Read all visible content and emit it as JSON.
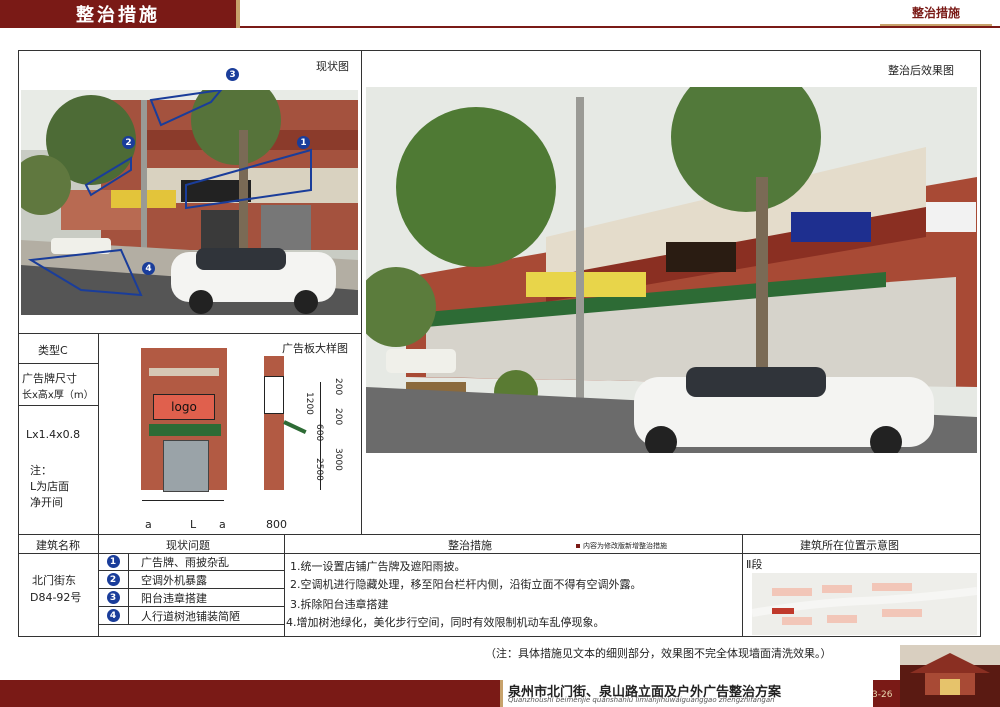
{
  "header": {
    "title": "整治措施",
    "right_title": "整治措施"
  },
  "left_photo": {
    "caption": "现状图",
    "markers": [
      "1",
      "2",
      "3",
      "4"
    ]
  },
  "right_photo": {
    "caption": "整治后效果图"
  },
  "spec": {
    "type_label": "类型C",
    "size_label_1": "广告牌尺寸",
    "size_label_2": "长x高x厚（m）",
    "size_value": "Lx1.4x0.8",
    "note_1": "注：",
    "note_2": "L为店面",
    "note_3": "净开间"
  },
  "sample": {
    "title": "广告板大样图",
    "logo_text": "logo",
    "dims": [
      "200",
      "1200",
      "200",
      "600",
      "2500",
      "3000",
      "800"
    ],
    "bottom_a1": "a",
    "bottom_L": "L",
    "bottom_a2": "a"
  },
  "table": {
    "headers": [
      "建筑名称",
      "现状问题",
      "整治措施",
      "建筑所在位置示意图"
    ],
    "legend_note": "内容为修改版新增整治措施",
    "building_name": "北门街东",
    "building_code": "D84-92号",
    "issues": [
      {
        "num": "1",
        "text": "广告牌、雨披杂乱"
      },
      {
        "num": "2",
        "text": "空调外机暴露"
      },
      {
        "num": "3",
        "text": "阳台违章搭建"
      },
      {
        "num": "4",
        "text": "人行道树池铺装简陋"
      }
    ],
    "measures": [
      "1.统一设置店铺广告牌及遮阳雨披。",
      "2.空调机进行隐藏处理，移至阳台栏杆内侧，沿街立面不得有空调外露。",
      "3.拆除阳台违章搭建",
      "4.增加树池绿化，美化步行空间，同时有效限制机动车乱停现象。"
    ],
    "location_label": "Ⅱ段"
  },
  "remark": "（注：具体措施见文本的细则部分，效果图不完全体现墙面清洗效果。）",
  "footer": {
    "title": "泉州市北门街、泉山路立面及户外广告整治方案",
    "subtitle": "Quanzhoushi beimenjie quanshanlu limianjihuwaiguanggao zhengzhifangan",
    "page": "3-26"
  },
  "colors": {
    "brand": "#7a1a16",
    "accent": "#c7a26b",
    "marker": "#1a3d9a"
  }
}
